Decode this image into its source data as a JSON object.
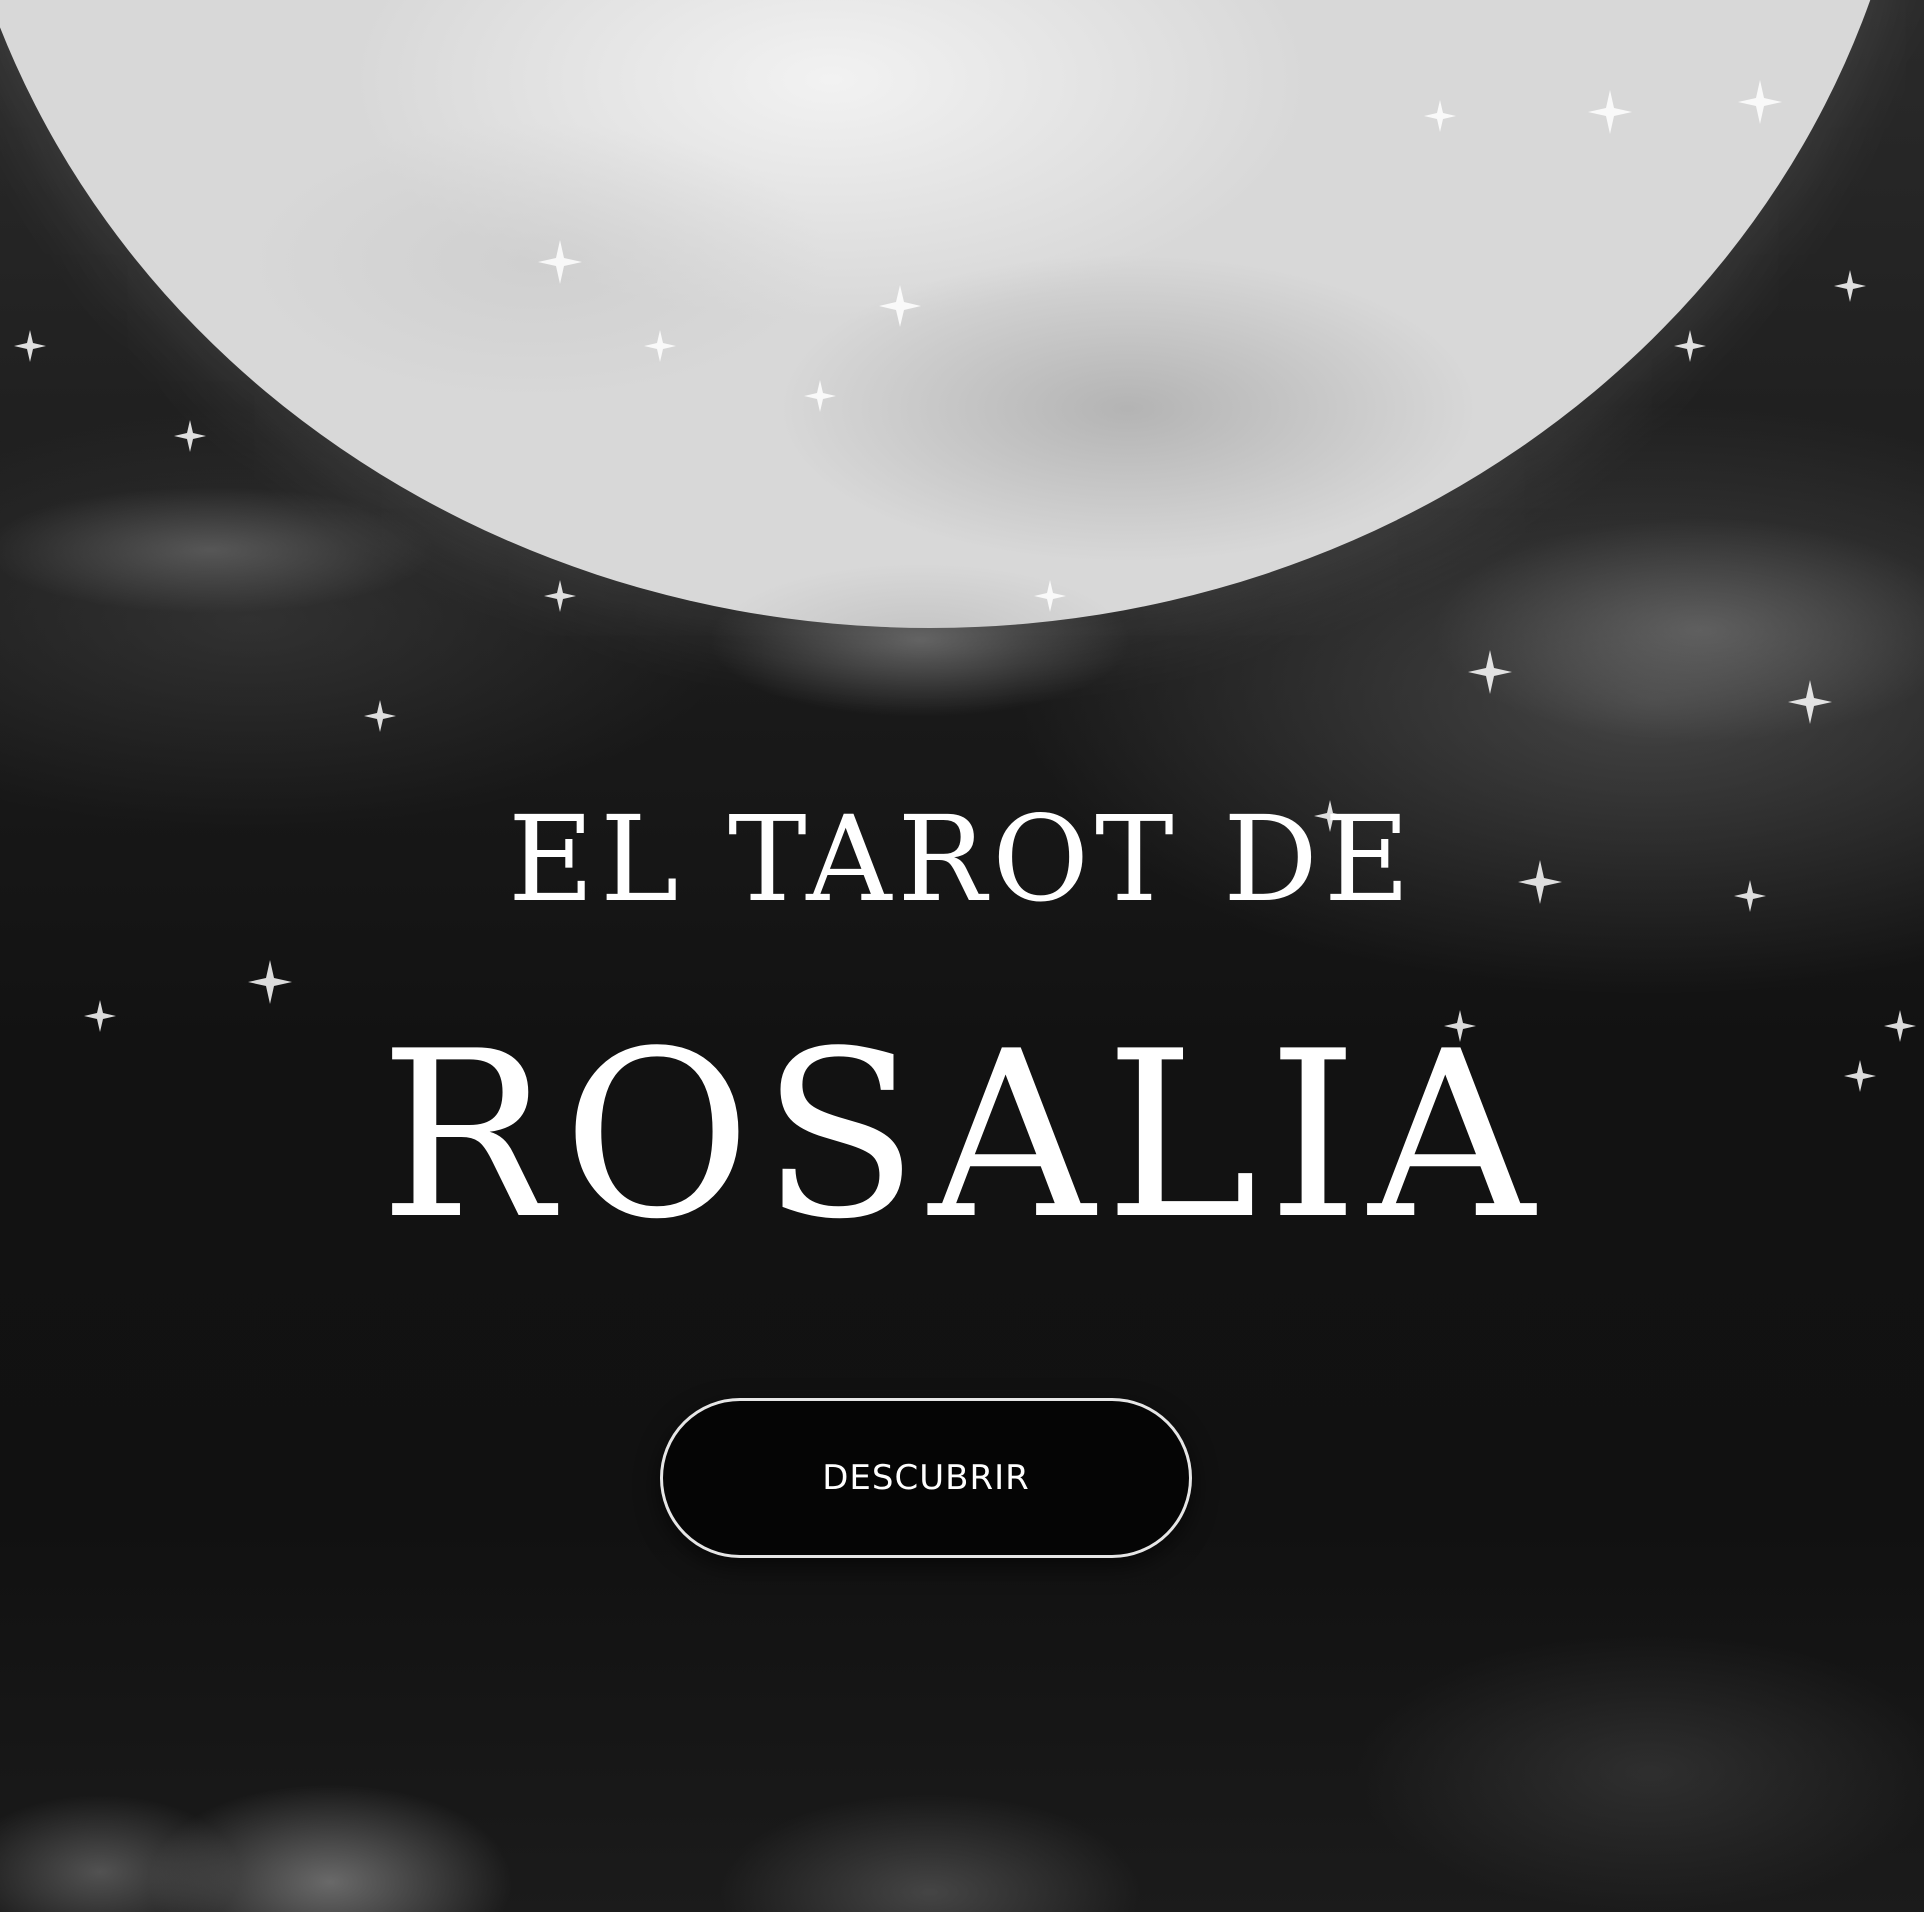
{
  "hero": {
    "title_line1": "EL TAROT DE",
    "title_line2": "ROSALIA",
    "cta_label": "DESCUBRIR"
  },
  "theme": {
    "background": "#121212",
    "text": "#ffffff",
    "button_bg": "#050505",
    "button_border": "#e6e6e6",
    "moon": "#e6e6e6"
  },
  "icons": [
    "moon",
    "sparkle-star",
    "cloud"
  ]
}
